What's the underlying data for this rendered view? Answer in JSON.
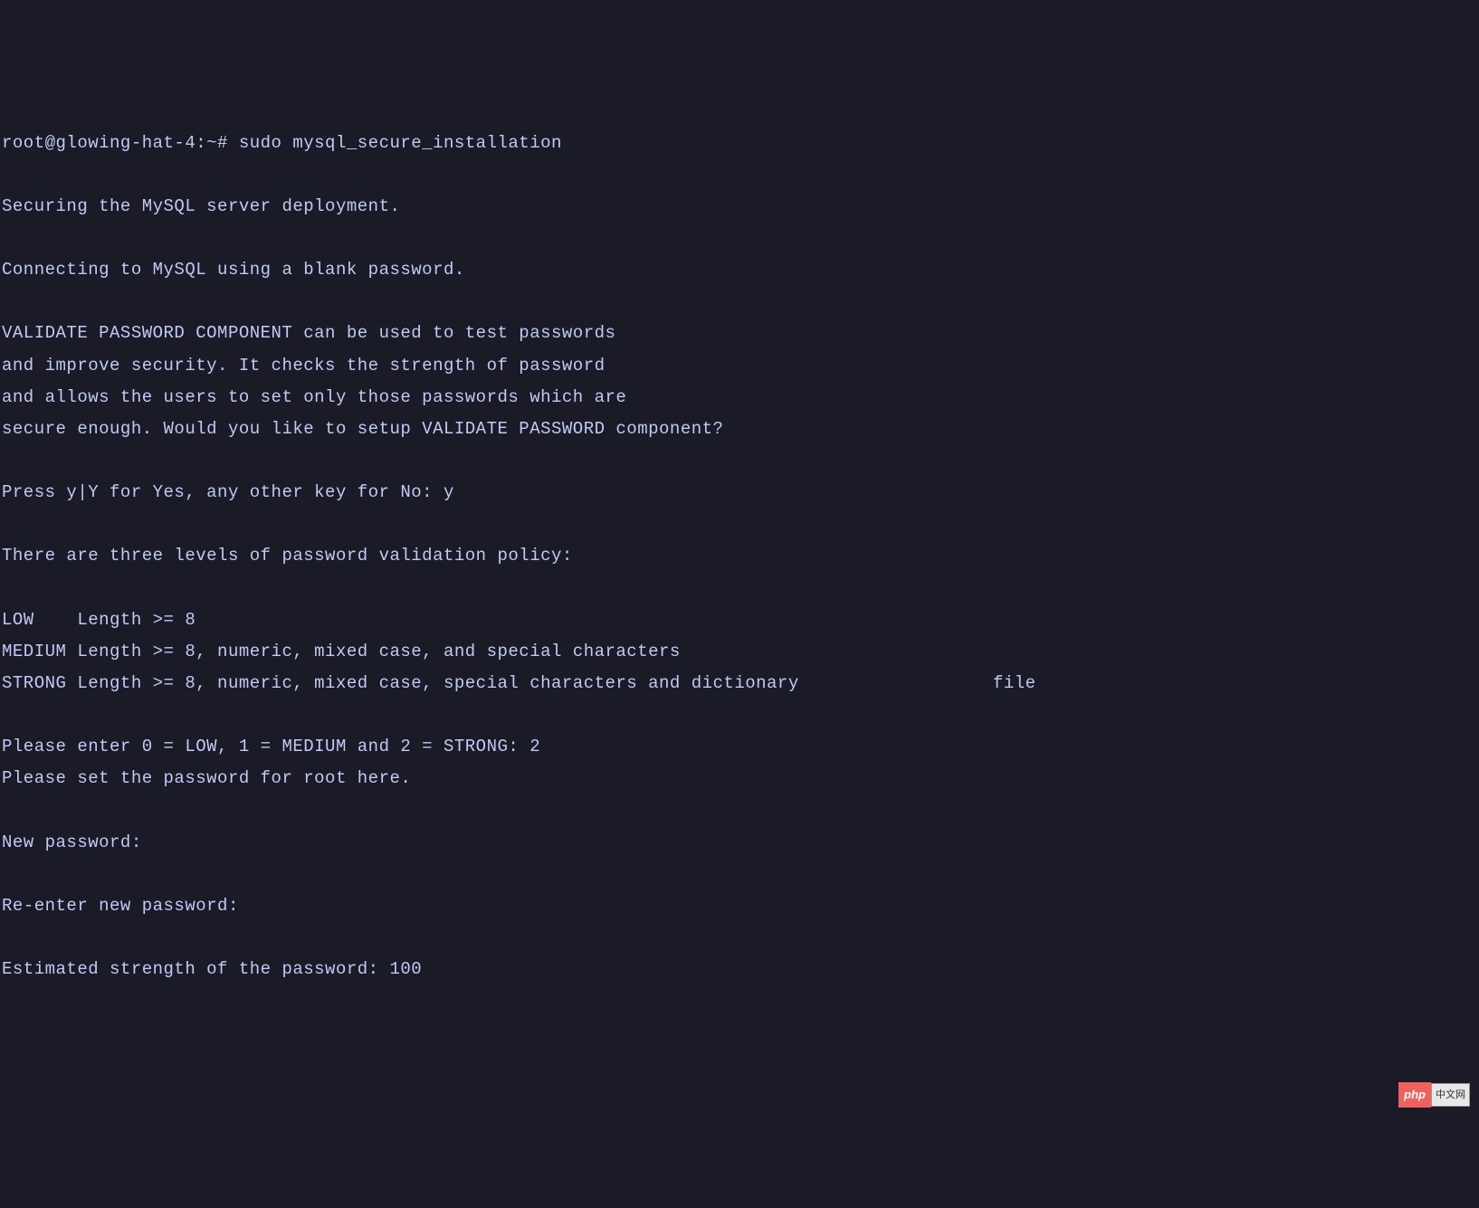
{
  "prompt": "root@glowing-hat-4:~# ",
  "command": "sudo mysql_secure_installation",
  "lines": {
    "l1": "Securing the MySQL server deployment.",
    "l2": "Connecting to MySQL using a blank password.",
    "l3": "VALIDATE PASSWORD COMPONENT can be used to test passwords",
    "l4": "and improve security. It checks the strength of password",
    "l5": "and allows the users to set only those passwords which are",
    "l6": "secure enough. Would you like to setup VALIDATE PASSWORD component?",
    "l7": "Press y|Y for Yes, any other key for No: y",
    "l8": "There are three levels of password validation policy:",
    "l9": "LOW    Length >= 8",
    "l10": "MEDIUM Length >= 8, numeric, mixed case, and special characters",
    "l11": "STRONG Length >= 8, numeric, mixed case, special characters and dictionary                  file",
    "l12": "Please enter 0 = LOW, 1 = MEDIUM and 2 = STRONG: 2",
    "l13": "Please set the password for root here.",
    "l14": "New password:",
    "l15": "Re-enter new password:",
    "l16": "Estimated strength of the password: 100"
  },
  "watermark": {
    "php": "php",
    "cn": "中文网"
  }
}
